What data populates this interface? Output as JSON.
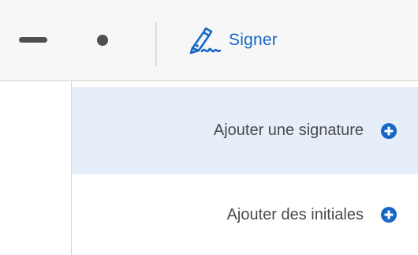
{
  "toolbar": {
    "line_tool_icon": "line-icon",
    "dot_tool_icon": "dot-icon",
    "sign_button": {
      "label": "Signer",
      "icon": "pen-signature-icon"
    }
  },
  "menu": {
    "items": [
      {
        "label": "Ajouter une signature",
        "icon": "plus-circle-icon",
        "highlighted": true
      },
      {
        "label": "Ajouter des initiales",
        "icon": "plus-circle-icon",
        "highlighted": false
      }
    ]
  },
  "colors": {
    "accent": "#1767c5",
    "highlight": "#e5eef9",
    "toolbar_bg": "#f7f7f7",
    "icon_gray": "#505050",
    "text_gray": "#4a4a4a"
  }
}
